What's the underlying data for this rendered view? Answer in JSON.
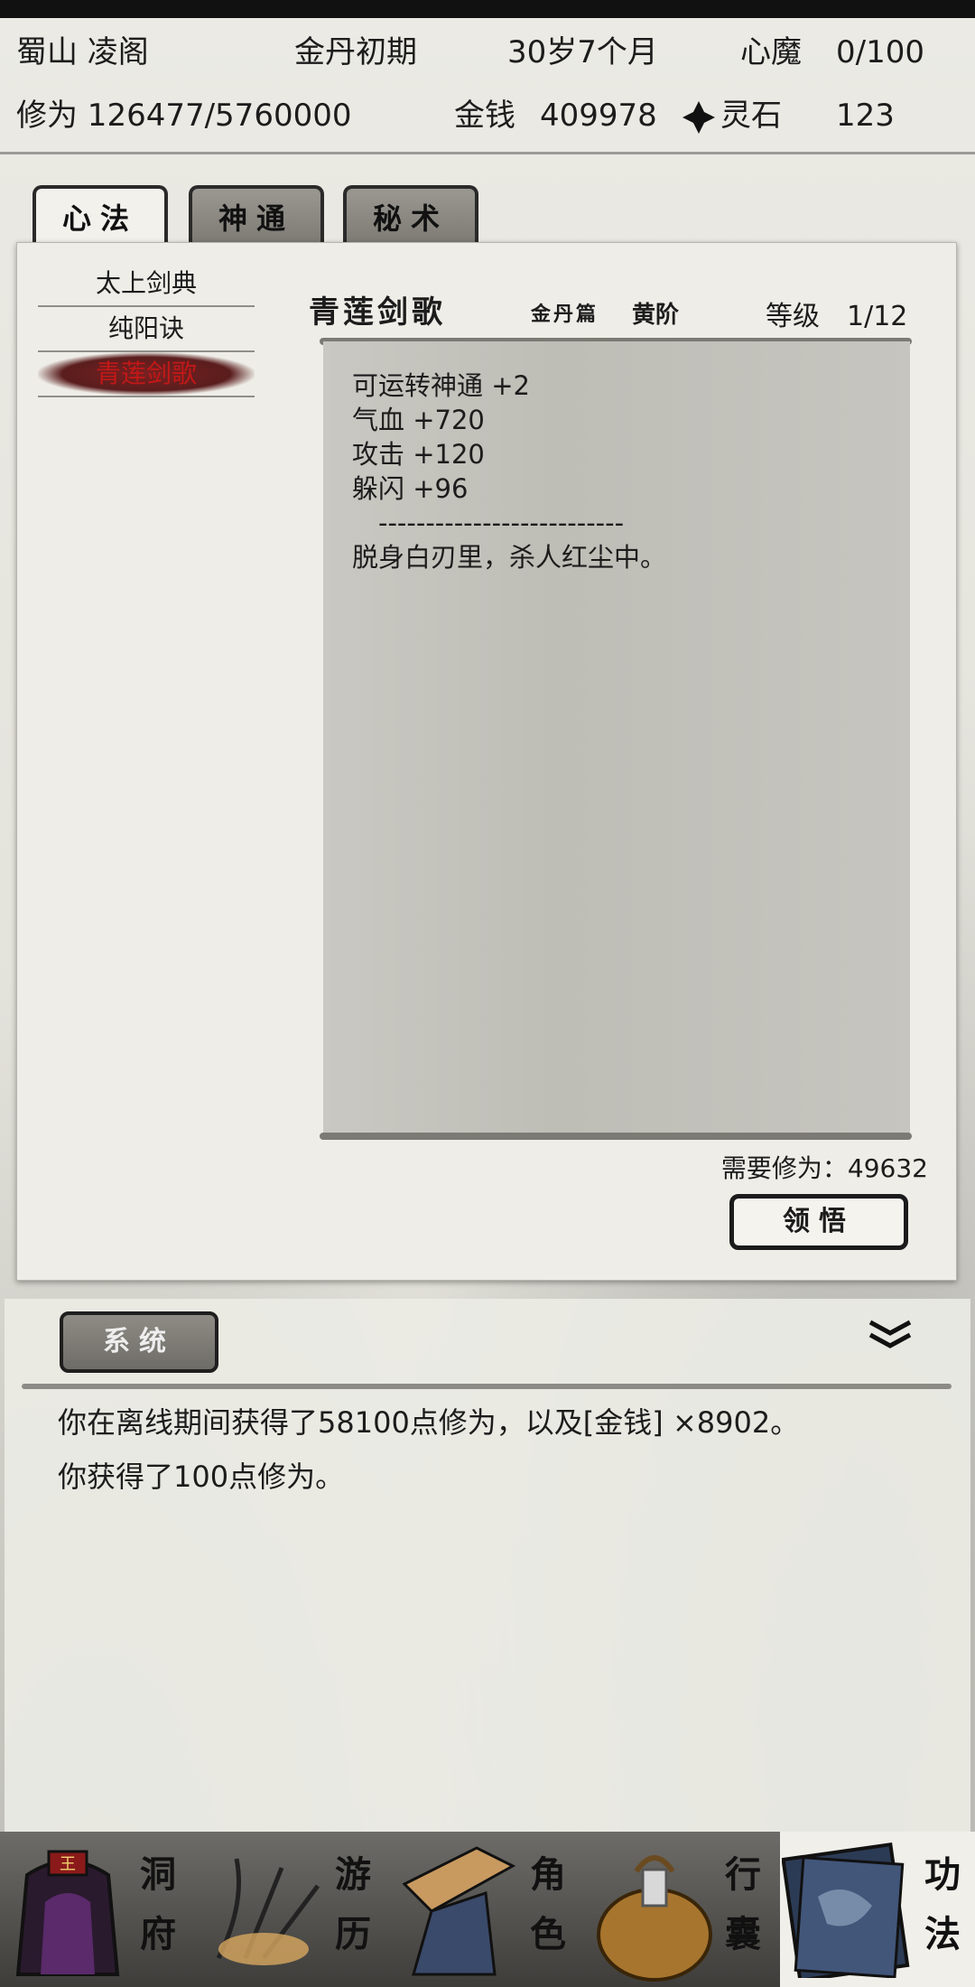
{
  "status": {
    "location": "蜀山 凌阁",
    "realm": "金丹初期",
    "age": "30岁7个月",
    "heart_demon_label": "心魔",
    "heart_demon_value": "0/100",
    "cultivation": "修为 126477/5760000",
    "money_label": "金钱",
    "money_value": "409978",
    "spirit_stone_label": "灵石",
    "spirit_stone_value": "123"
  },
  "tabs": [
    {
      "label": "心法",
      "active": true
    },
    {
      "label": "神通",
      "active": false
    },
    {
      "label": "秘术",
      "active": false
    }
  ],
  "skill_list": [
    {
      "label": "太上剑典",
      "selected": false
    },
    {
      "label": "纯阳诀",
      "selected": false
    },
    {
      "label": "青莲剑歌",
      "selected": true
    }
  ],
  "detail": {
    "title": "青莲剑歌",
    "subtitle": "金丹篇",
    "grade": "黄阶",
    "level": "等级　1/12",
    "attributes": [
      "可运转神通 +2",
      "气血 +720",
      "攻击 +120",
      "躲闪 +96",
      "　--------------------------",
      "脱身白刃里，杀人红尘中。"
    ],
    "required": "需要修为：49632",
    "learn_button": "领悟"
  },
  "system": {
    "tab_label": "系统",
    "messages": [
      "你在离线期间获得了58100点修为，以及[金钱] ×8902。",
      "你获得了100点修为。"
    ]
  },
  "nav": [
    {
      "top": "洞",
      "bottom": "府",
      "icon": "cave-dwelling-icon"
    },
    {
      "top": "游",
      "bottom": "历",
      "icon": "travel-icon"
    },
    {
      "top": "角",
      "bottom": "色",
      "icon": "character-icon"
    },
    {
      "top": "行",
      "bottom": "囊",
      "icon": "bag-icon"
    },
    {
      "top": "功",
      "bottom": "法",
      "icon": "skills-book-icon"
    }
  ],
  "colors": {
    "selected_text": "#c21818",
    "panel_bg": "#eeede7"
  }
}
